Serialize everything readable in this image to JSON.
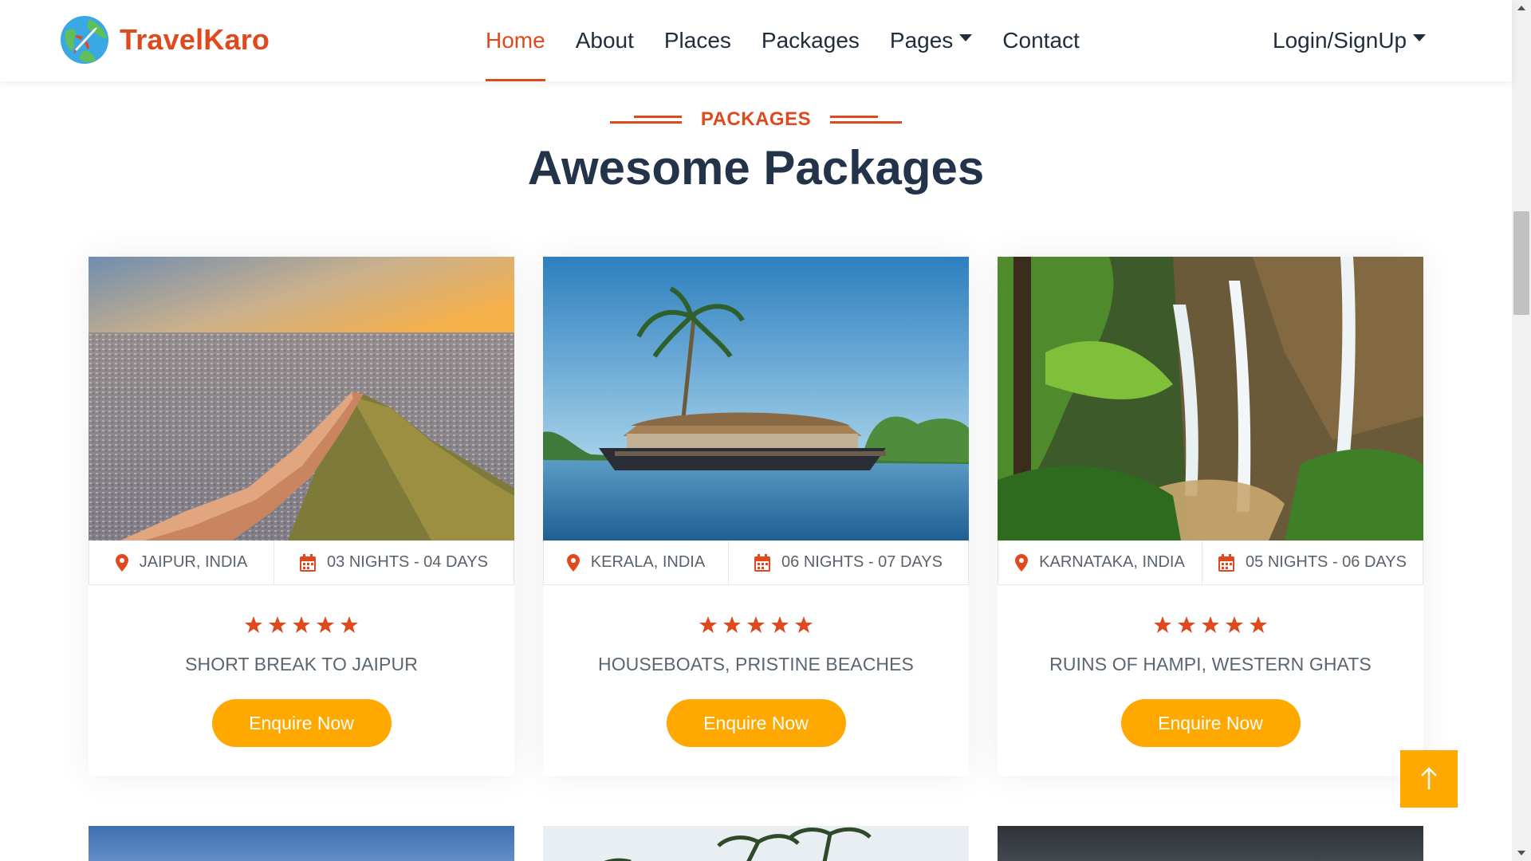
{
  "brand": {
    "name": "TravelKaro",
    "color": "#e0491d"
  },
  "nav": {
    "items": [
      {
        "label": "Home",
        "active": true
      },
      {
        "label": "About",
        "active": false
      },
      {
        "label": "Places",
        "active": false
      },
      {
        "label": "Packages",
        "active": false
      },
      {
        "label": "Pages",
        "active": false
      },
      {
        "label": "Contact",
        "active": false
      }
    ],
    "login_label": "Login/SignUp"
  },
  "section": {
    "eyebrow": "PACKAGES",
    "title": "Awesome Packages"
  },
  "packages": [
    {
      "location": "JAIPUR, INDIA",
      "duration": "03 NIGHTS - 04 DAYS",
      "rating": 5,
      "title": "SHORT BREAK TO JAIPUR",
      "cta": "Enquire Now",
      "image": "jaipur-fort-wall-photo"
    },
    {
      "location": "KERALA, INDIA",
      "duration": "06 NIGHTS - 07 DAYS",
      "rating": 5,
      "title": "HOUSEBOATS, PRISTINE BEACHES",
      "cta": "Enquire Now",
      "image": "kerala-houseboat-photo"
    },
    {
      "location": "KARNATAKA, INDIA",
      "duration": "05 NIGHTS - 06 DAYS",
      "rating": 5,
      "title": "RUINS OF HAMPI, WESTERN GHATS",
      "cta": "Enquire Now",
      "image": "karnataka-waterfall-photo"
    }
  ],
  "colors": {
    "accent": "#e0491d",
    "button": "#ffa800",
    "heading": "#23344a"
  },
  "icons": {
    "location": "map-pin-icon",
    "duration": "calendar-icon",
    "rating": "star-icon",
    "back_to_top": "arrow-up-icon"
  }
}
